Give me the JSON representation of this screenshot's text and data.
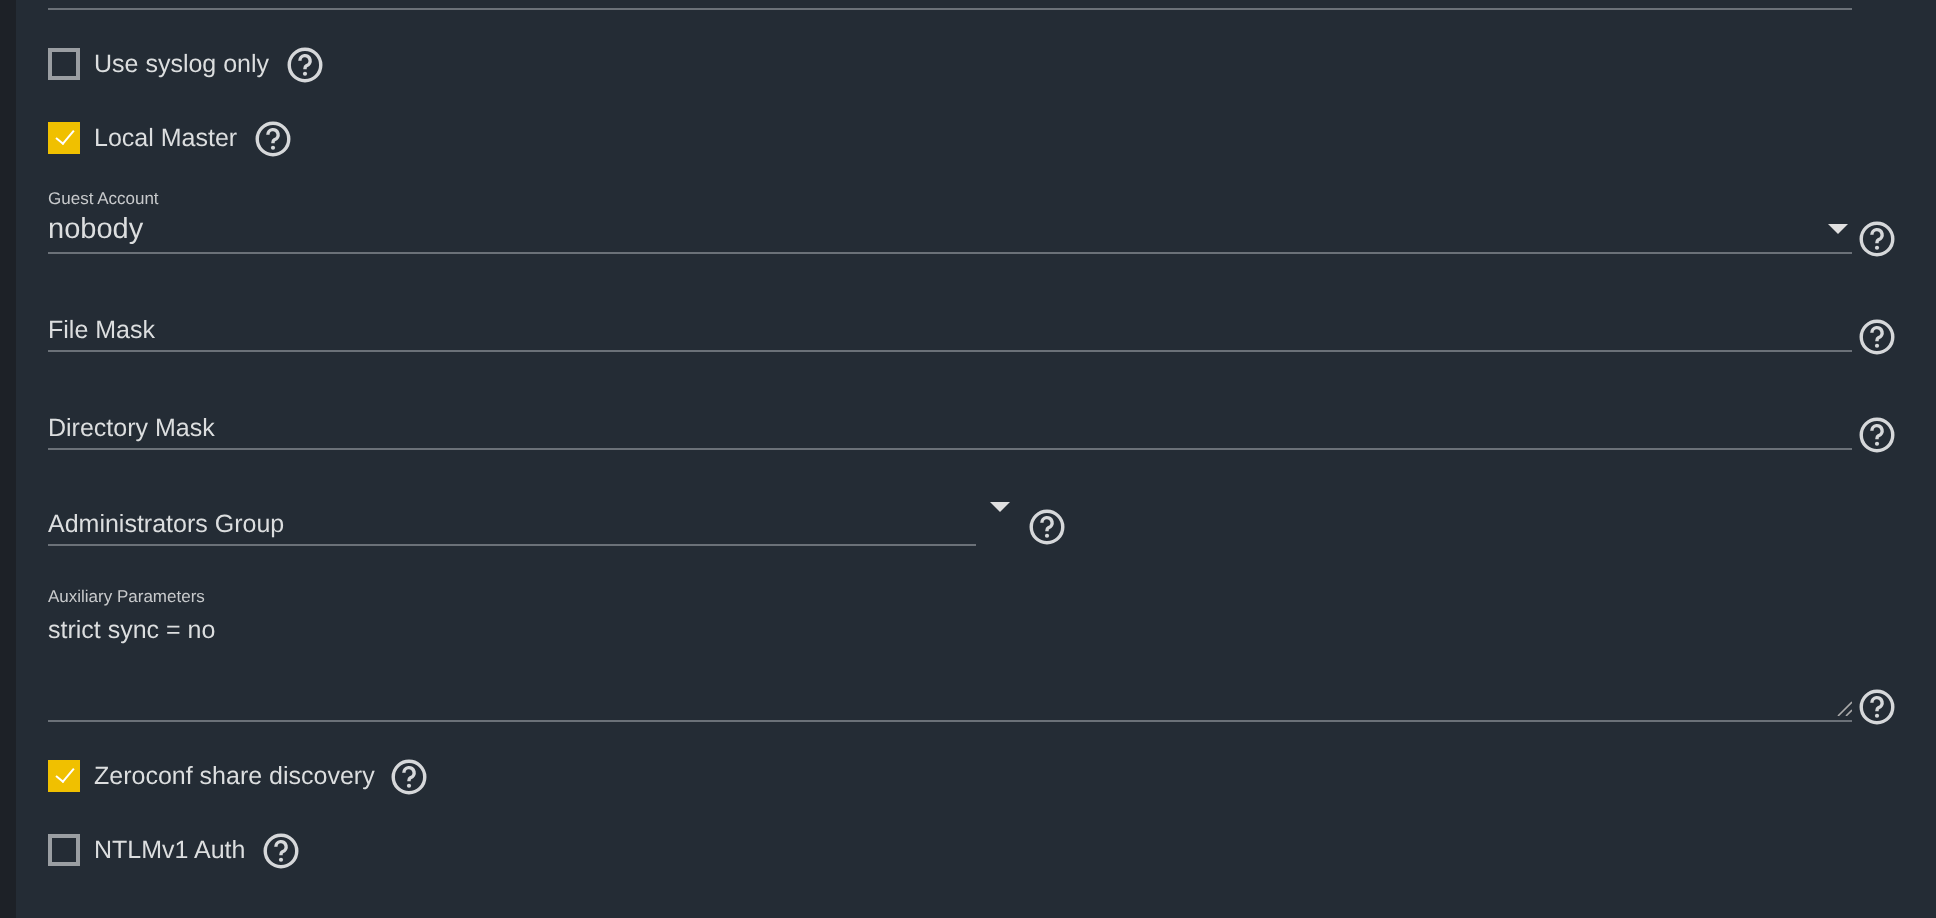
{
  "fields": [
    {
      "kind": "checkbox",
      "label": "Use syslog only",
      "checked": false
    },
    {
      "kind": "checkbox",
      "label": "Local Master",
      "checked": true
    },
    {
      "kind": "select",
      "label": "Guest Account",
      "value": "nobody"
    },
    {
      "kind": "input",
      "placeholder": "File Mask"
    },
    {
      "kind": "input",
      "placeholder": "Directory Mask"
    },
    {
      "kind": "combo",
      "placeholder": "Administrators Group"
    },
    {
      "kind": "textarea",
      "label": "Auxiliary Parameters",
      "value": "strict sync = no"
    },
    {
      "kind": "checkbox",
      "label": "Zeroconf share discovery",
      "checked": true
    },
    {
      "kind": "checkbox",
      "label": "NTLMv1 Auth",
      "checked": false
    }
  ]
}
